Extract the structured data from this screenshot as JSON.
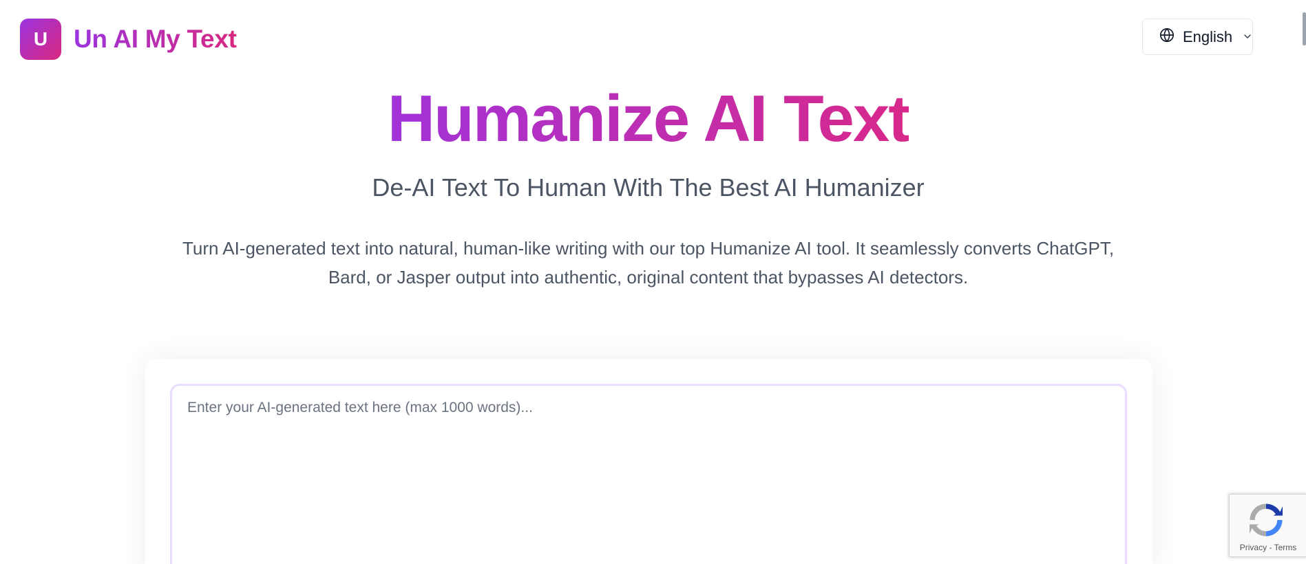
{
  "header": {
    "logo_letter": "U",
    "brand_name": "Un AI My Text",
    "language": {
      "icon": "globe-icon",
      "label": "English",
      "chevron": "chevron-down-icon"
    }
  },
  "hero": {
    "title": "Humanize AI Text",
    "subtitle": "De-AI Text To Human With The Best AI Humanizer",
    "description": "Turn AI-generated text into natural, human-like writing with our top Humanize AI tool. It seamlessly converts ChatGPT, Bard, or Jasper output into authentic, original content that bypasses AI detectors."
  },
  "editor": {
    "value": "",
    "placeholder": "Enter your AI-generated text here (max 1000 words)..."
  },
  "recaptcha": {
    "icon": "recaptcha-icon",
    "privacy_label": "Privacy",
    "separator": " - ",
    "terms_label": "Terms"
  },
  "colors": {
    "brand_gradient_start": "#9b33e0",
    "brand_gradient_end": "#d9287e",
    "editor_border": "#eadcff",
    "muted_text": "#4b5563"
  }
}
